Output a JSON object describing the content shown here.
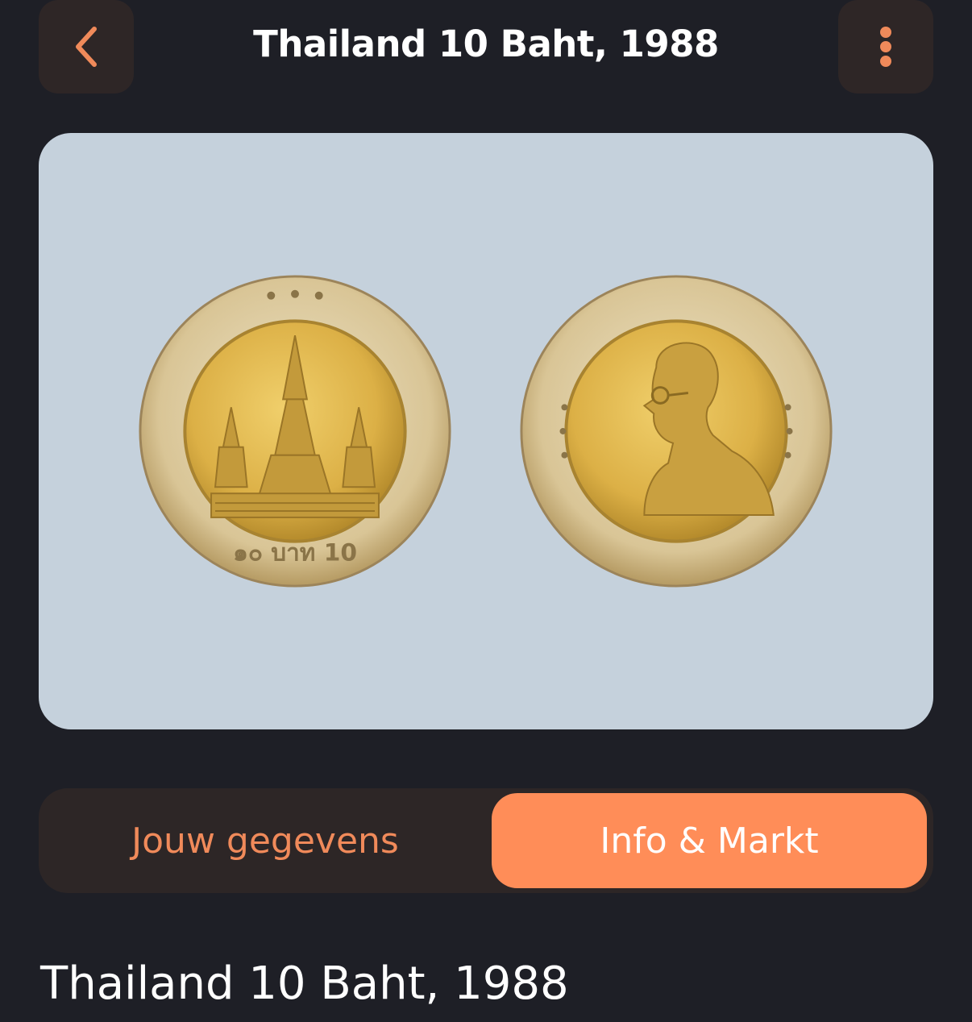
{
  "header": {
    "title": "Thailand 10 Baht, 1988",
    "back_icon": "chevron-left-icon",
    "menu_icon": "more-vertical-icon"
  },
  "coin": {
    "obverse_legend_bottom": "๑๐ บาท 10",
    "images": [
      "temple-side",
      "portrait-side"
    ]
  },
  "tabs": [
    {
      "label": "Jouw gegevens",
      "active": false
    },
    {
      "label": "Info & Markt",
      "active": true
    }
  ],
  "content": {
    "title": "Thailand 10 Baht, 1988"
  },
  "colors": {
    "background": "#1e1f26",
    "accent": "#ff8d58",
    "card": "#c5d1dc",
    "button_bg": "#2e2626"
  }
}
